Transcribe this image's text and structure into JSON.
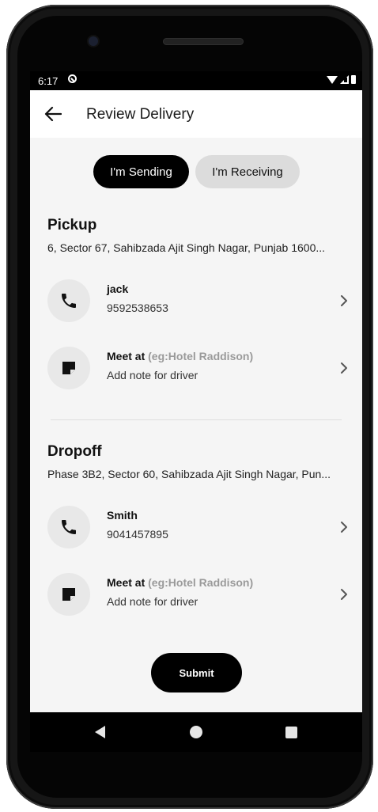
{
  "status_bar": {
    "time": "6:17"
  },
  "app_bar": {
    "title": "Review Delivery",
    "back_icon": "arrow-left-icon"
  },
  "toggle": {
    "sending_label": "I'm Sending",
    "receiving_label": "I'm Receiving",
    "selected": "sending"
  },
  "pickup": {
    "title": "Pickup",
    "address": "6, Sector 67, Sahibzada Ajit Singh Nagar, Punjab 1600...",
    "contact": {
      "name": "jack",
      "phone": "9592538653",
      "icon": "phone-icon"
    },
    "note": {
      "label": "Meet at",
      "hint": "(eg:Hotel Raddison)",
      "subtitle": "Add note for driver",
      "icon": "note-icon"
    }
  },
  "dropoff": {
    "title": "Dropoff",
    "address": "Phase 3B2, Sector 60, Sahibzada Ajit Singh Nagar, Pun...",
    "contact": {
      "name": "Smith",
      "phone": "9041457895",
      "icon": "phone-icon"
    },
    "note": {
      "label": "Meet at",
      "hint": "(eg:Hotel Raddison)",
      "subtitle": "Add note for driver",
      "icon": "note-icon"
    }
  },
  "submit_label": "Submit",
  "colors": {
    "primary": "#000000",
    "toggle_inactive": "#dcdcdc",
    "background": "#f5f5f5",
    "hint_text": "#9a9a9a"
  }
}
